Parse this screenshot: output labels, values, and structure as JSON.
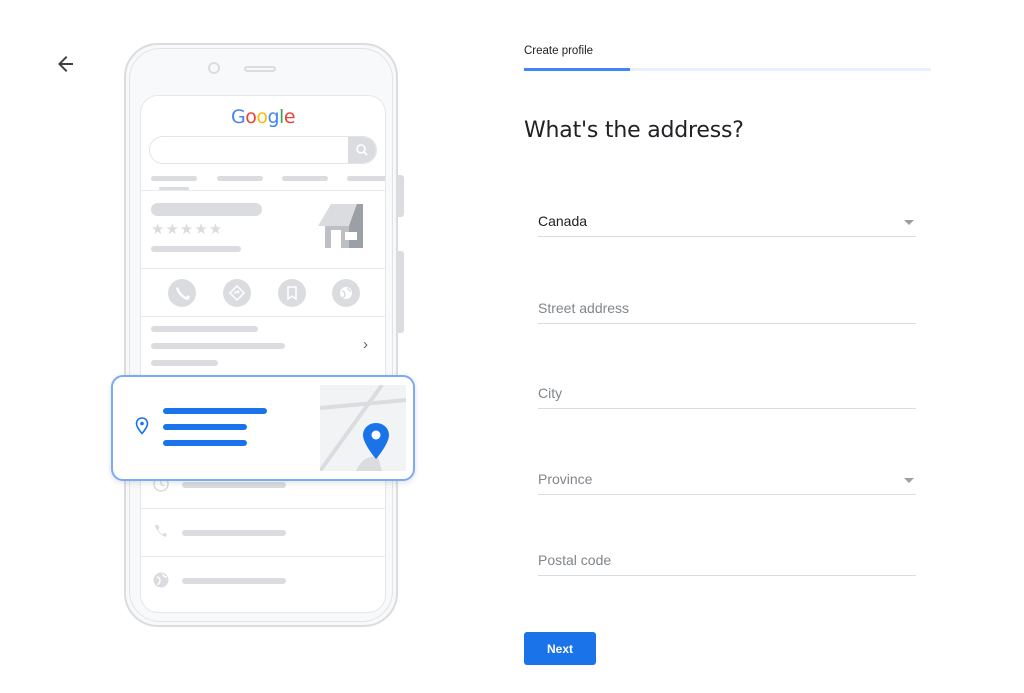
{
  "nav": {
    "back_icon": "arrow-left-icon"
  },
  "illustration": {
    "logo_letters": [
      {
        "ch": "G",
        "color": "#4285f4"
      },
      {
        "ch": "o",
        "color": "#ea4335"
      },
      {
        "ch": "o",
        "color": "#fbbc05"
      },
      {
        "ch": "g",
        "color": "#4285f4"
      },
      {
        "ch": "l",
        "color": "#34a853"
      },
      {
        "ch": "e",
        "color": "#ea4335"
      }
    ],
    "stars": "★★★★★",
    "chevron": "›",
    "action_icons": [
      "phone-icon",
      "directions-icon",
      "bookmark-icon",
      "globe-icon"
    ],
    "detail_icons": [
      "clock-icon",
      "phone-icon",
      "globe-icon"
    ],
    "accent_color": "#1a73e8"
  },
  "header": {
    "step_label": "Create profile",
    "progress_fraction": 0.26
  },
  "form": {
    "title": "What's the address?",
    "country": {
      "value": "Canada",
      "type": "dropdown"
    },
    "street": {
      "placeholder": "Street address"
    },
    "city": {
      "placeholder": "City"
    },
    "province": {
      "placeholder": "Province",
      "type": "dropdown"
    },
    "postal": {
      "placeholder": "Postal code"
    },
    "next_label": "Next"
  },
  "colors": {
    "primary": "#1a73e8",
    "progress_fill": "#4285f4",
    "progress_track": "#e8f0fe"
  }
}
